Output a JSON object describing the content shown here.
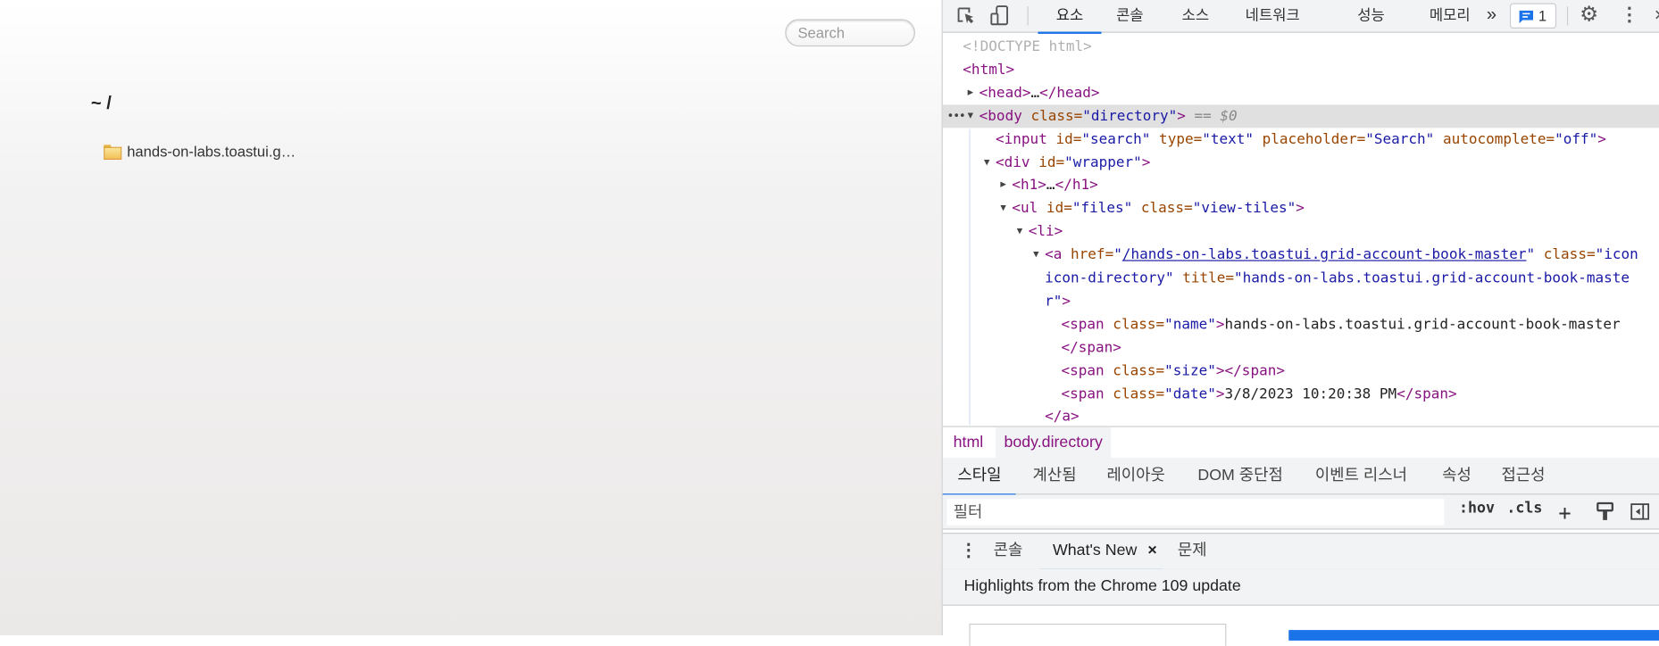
{
  "page": {
    "search_placeholder": "Search",
    "heading": "~ /",
    "files": [
      {
        "name": "hands-on-labs.toastui.g…",
        "icon": "folder-icon"
      }
    ]
  },
  "devtools": {
    "toolbar": {
      "tabs": [
        "요소",
        "콘솔",
        "소스",
        "네트워크",
        "성능",
        "메모리"
      ],
      "active_tab": "요소",
      "more": "»",
      "issues_count": "1"
    },
    "elements": [
      {
        "depth": 0,
        "tokens": [
          [
            "doc",
            "<!DOCTYPE html>"
          ]
        ]
      },
      {
        "depth": 0,
        "tokens": [
          [
            "tag",
            "<html>"
          ]
        ]
      },
      {
        "depth": 1,
        "toggle": "collapsed",
        "tokens": [
          [
            "tag",
            "<head>"
          ],
          [
            "text",
            "…"
          ],
          [
            "tag",
            "</head>"
          ]
        ]
      },
      {
        "depth": 1,
        "toggle": "expanded",
        "selected": true,
        "tokens": [
          [
            "tag",
            "<body "
          ],
          [
            "attr",
            "class="
          ],
          [
            "val",
            "\"directory\""
          ],
          [
            "tag",
            ">"
          ],
          [
            "eq",
            " == $0"
          ]
        ]
      },
      {
        "depth": 2,
        "tokens": [
          [
            "tag",
            "<input "
          ],
          [
            "attr",
            "id="
          ],
          [
            "val",
            "\"search\""
          ],
          [
            "attr",
            " type="
          ],
          [
            "val",
            "\"text\""
          ],
          [
            "attr",
            " placeholder="
          ],
          [
            "val",
            "\"Search\""
          ],
          [
            "attr",
            " autocomplete="
          ],
          [
            "val",
            "\"off\""
          ],
          [
            "tag",
            ">"
          ]
        ]
      },
      {
        "depth": 2,
        "toggle": "expanded",
        "tokens": [
          [
            "tag",
            "<div "
          ],
          [
            "attr",
            "id="
          ],
          [
            "val",
            "\"wrapper\""
          ],
          [
            "tag",
            ">"
          ]
        ]
      },
      {
        "depth": 3,
        "toggle": "collapsed",
        "tokens": [
          [
            "tag",
            "<h1>"
          ],
          [
            "text",
            "…"
          ],
          [
            "tag",
            "</h1>"
          ]
        ]
      },
      {
        "depth": 3,
        "toggle": "expanded",
        "tokens": [
          [
            "tag",
            "<ul "
          ],
          [
            "attr",
            "id="
          ],
          [
            "val",
            "\"files\""
          ],
          [
            "attr",
            " class="
          ],
          [
            "val",
            "\"view-tiles\""
          ],
          [
            "tag",
            ">"
          ]
        ]
      },
      {
        "depth": 4,
        "toggle": "expanded",
        "tokens": [
          [
            "tag",
            "<li>"
          ]
        ]
      },
      {
        "depth": 5,
        "toggle": "expanded",
        "tokens": [
          [
            "tag",
            "<a "
          ],
          [
            "attr",
            "href="
          ],
          [
            "val",
            "\""
          ],
          [
            "link",
            "/hands-on-labs.toastui.grid-account-book-master"
          ],
          [
            "val",
            "\""
          ],
          [
            "attr",
            " class="
          ],
          [
            "val",
            "\"icon"
          ]
        ]
      },
      {
        "depth": 5,
        "tokens": [
          [
            "val",
            "icon-directory\""
          ],
          [
            "attr",
            " title="
          ],
          [
            "val",
            "\"hands-on-labs.toastui.grid-account-book-maste"
          ]
        ]
      },
      {
        "depth": 5,
        "tokens": [
          [
            "val",
            "r\""
          ],
          [
            "tag",
            ">"
          ]
        ]
      },
      {
        "depth": 6,
        "tokens": [
          [
            "tag",
            "<span "
          ],
          [
            "attr",
            "class="
          ],
          [
            "val",
            "\"name\""
          ],
          [
            "tag",
            ">"
          ],
          [
            "text",
            "hands-on-labs.toastui.grid-account-book-master"
          ]
        ]
      },
      {
        "depth": 6,
        "tokens": [
          [
            "tag",
            "</span>"
          ]
        ]
      },
      {
        "depth": 6,
        "tokens": [
          [
            "tag",
            "<span "
          ],
          [
            "attr",
            "class="
          ],
          [
            "val",
            "\"size\""
          ],
          [
            "tag",
            "></span>"
          ]
        ]
      },
      {
        "depth": 6,
        "tokens": [
          [
            "tag",
            "<span "
          ],
          [
            "attr",
            "class="
          ],
          [
            "val",
            "\"date\""
          ],
          [
            "tag",
            ">"
          ],
          [
            "text",
            "3/8/2023 10:20:38 PM"
          ],
          [
            "tag",
            "</span>"
          ]
        ]
      },
      {
        "depth": 5,
        "tokens": [
          [
            "tag",
            "</a>"
          ]
        ]
      }
    ],
    "breadcrumb": [
      "html",
      "body.directory"
    ],
    "styles_tabs": [
      "스타일",
      "계산됨",
      "레이아웃",
      "DOM 중단점",
      "이벤트 리스너",
      "속성",
      "접근성"
    ],
    "filter_placeholder": "필터",
    "filter_buttons": [
      ":hov",
      ".cls",
      "+"
    ],
    "drawer_tabs": [
      "콘솔",
      "What's New",
      "문제"
    ],
    "drawer_close": "×",
    "whats_new_heading": "Highlights from the Chrome 109 update"
  }
}
